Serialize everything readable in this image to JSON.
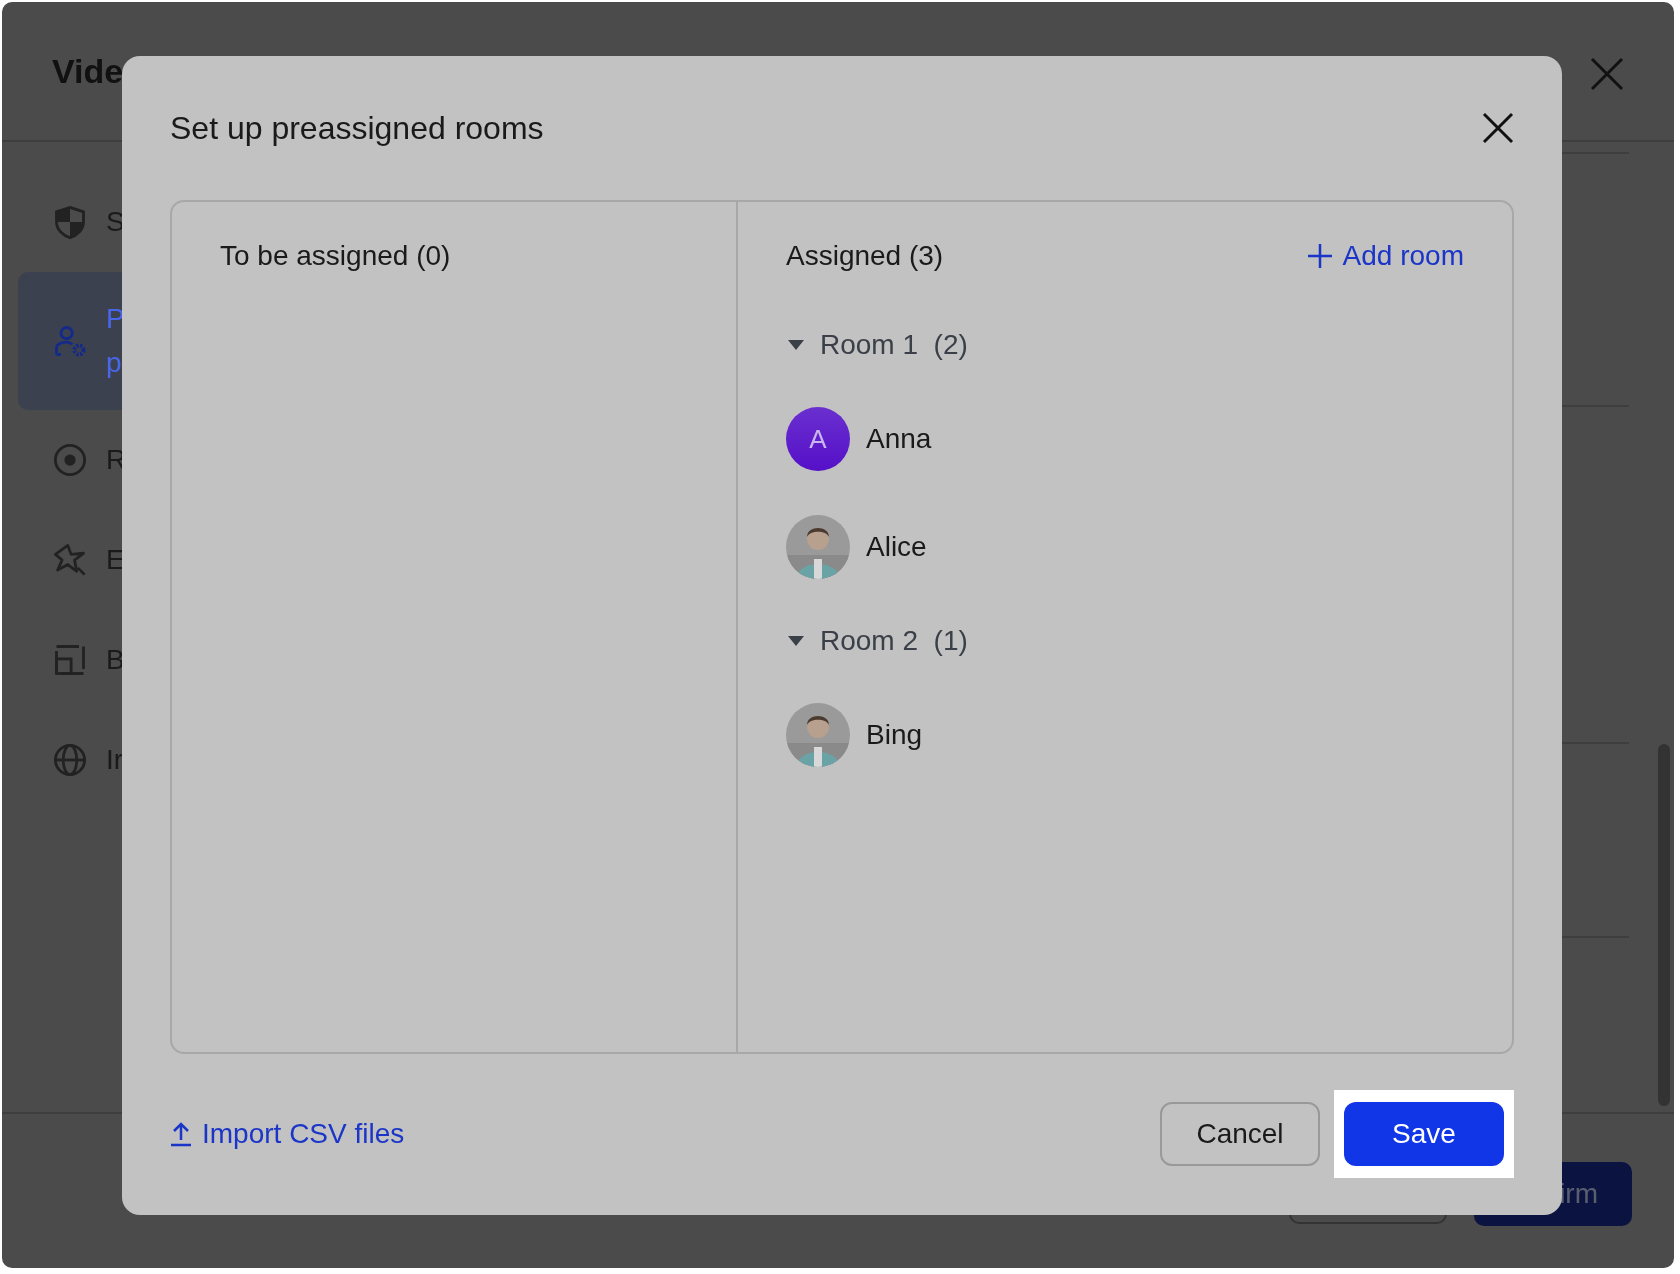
{
  "background": {
    "title": "Vide",
    "sidebar": [
      {
        "lines": [
          "S"
        ],
        "selected": false
      },
      {
        "lines": [
          "P",
          "p"
        ],
        "selected": true
      },
      {
        "lines": [
          "R"
        ],
        "selected": false
      },
      {
        "lines": [
          "E"
        ],
        "selected": false
      },
      {
        "lines": [
          "B"
        ],
        "selected": false
      },
      {
        "lines": [
          "Ir"
        ],
        "selected": false
      }
    ],
    "confirm_button": "irm"
  },
  "dialog": {
    "title": "Set up preassigned rooms",
    "unassigned": {
      "header": "To be assigned (0)"
    },
    "assigned": {
      "header": "Assigned (3)",
      "add_room": "Add room",
      "rooms": [
        {
          "name": "Room 1",
          "count": "(2)",
          "expanded": true,
          "members": [
            {
              "name": "Anna",
              "kind": "initial",
              "initial": "A"
            },
            {
              "name": "Alice",
              "kind": "picture"
            }
          ]
        },
        {
          "name": "Room 2",
          "count": "(1)",
          "expanded": true,
          "members": [
            {
              "name": "Bing",
              "kind": "picture"
            }
          ]
        }
      ]
    },
    "import": "Import CSV files",
    "cancel": "Cancel",
    "save": "Save"
  }
}
